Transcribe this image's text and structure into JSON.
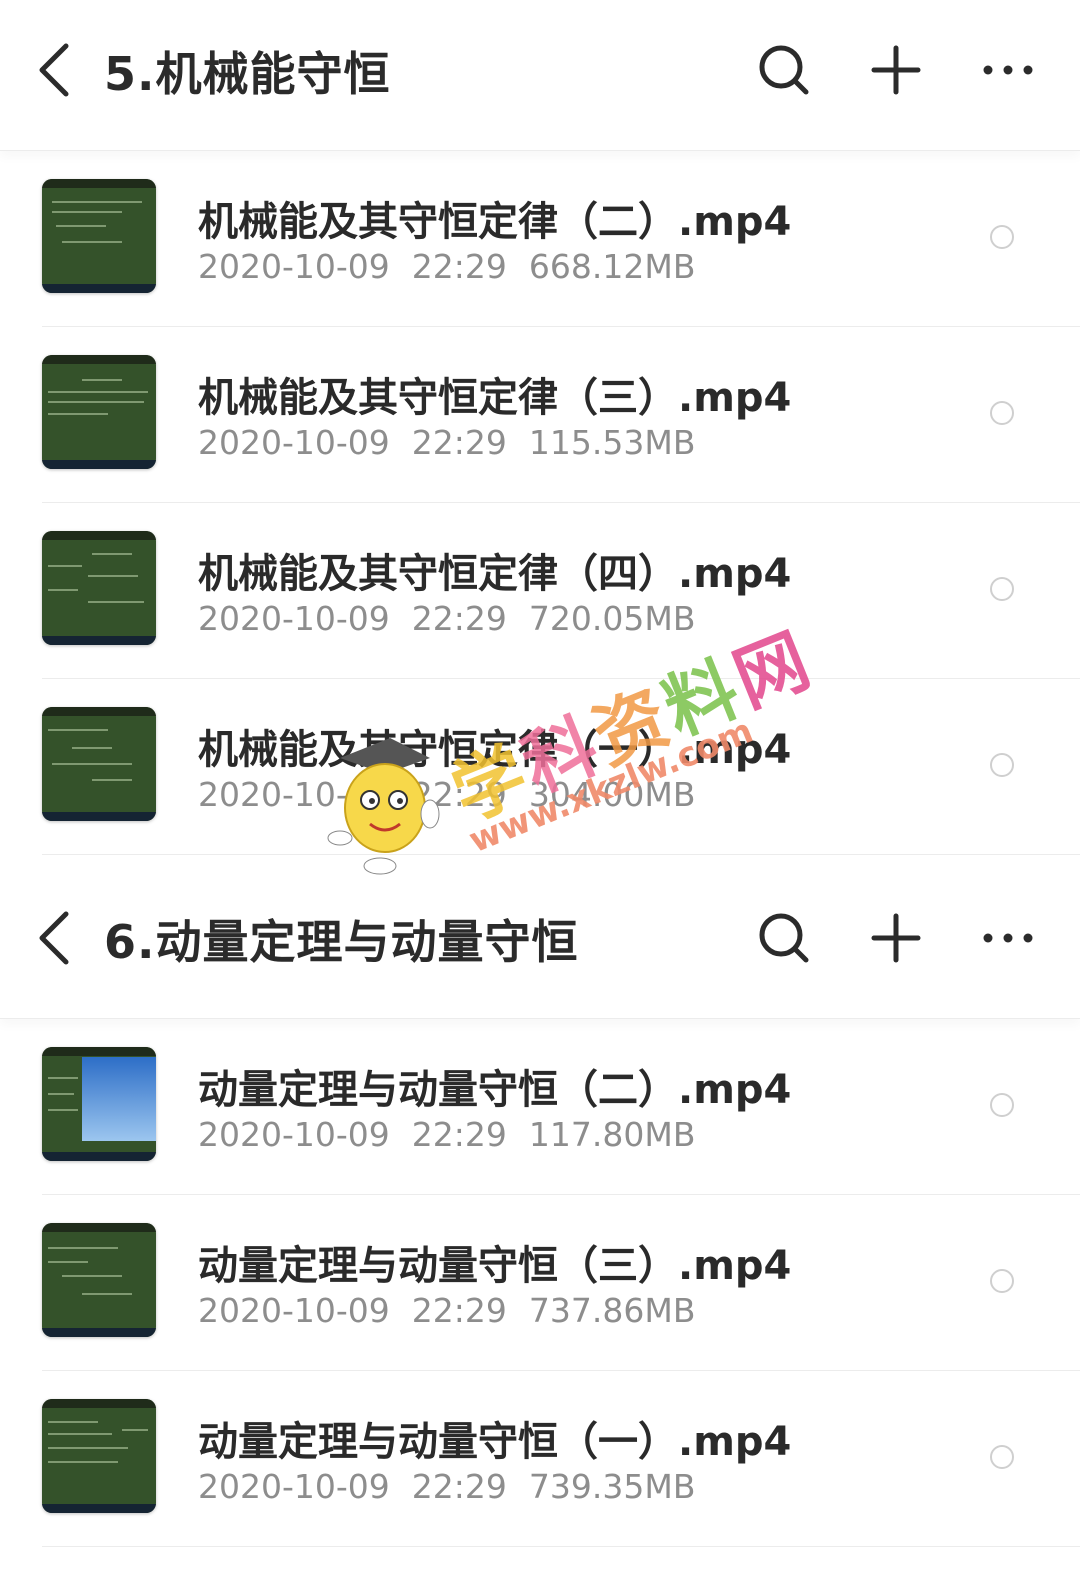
{
  "folders": [
    {
      "title": "5.机械能守恒",
      "files": [
        {
          "name": "机械能及其守恒定律（二）.mp4",
          "date": "2020-10-09",
          "time": "22:29",
          "size": "668.12MB"
        },
        {
          "name": "机械能及其守恒定律（三）.mp4",
          "date": "2020-10-09",
          "time": "22:29",
          "size": "115.53MB"
        },
        {
          "name": "机械能及其守恒定律（四）.mp4",
          "date": "2020-10-09",
          "time": "22:29",
          "size": "720.05MB"
        },
        {
          "name": "机械能及其守恒定律（一）.mp4",
          "date": "2020-10-09",
          "time": "22:29",
          "size": "304.00MB"
        }
      ]
    },
    {
      "title": "6.动量定理与动量守恒",
      "files": [
        {
          "name": "动量定理与动量守恒（二）.mp4",
          "date": "2020-10-09",
          "time": "22:29",
          "size": "117.80MB"
        },
        {
          "name": "动量定理与动量守恒（三）.mp4",
          "date": "2020-10-09",
          "time": "22:29",
          "size": "737.86MB"
        },
        {
          "name": "动量定理与动量守恒（一）.mp4",
          "date": "2020-10-09",
          "time": "22:29",
          "size": "739.35MB"
        }
      ]
    }
  ],
  "icons": {
    "back": "chevron-left-icon",
    "search": "search-icon",
    "add": "plus-icon",
    "more": "more-horizontal-icon",
    "select": "radio-circle-icon"
  },
  "watermark": {
    "chars": [
      "学",
      "科",
      "资",
      "料",
      "网"
    ],
    "char_colors": [
      "#f2c230",
      "#ef6f9a",
      "#f29a45",
      "#7ac14a",
      "#e2468c"
    ],
    "url": "www.xkzlw.com"
  },
  "colors": {
    "title": "#2b2b2b",
    "meta": "#8d8d8d",
    "thumb_bg": "#34522a"
  }
}
